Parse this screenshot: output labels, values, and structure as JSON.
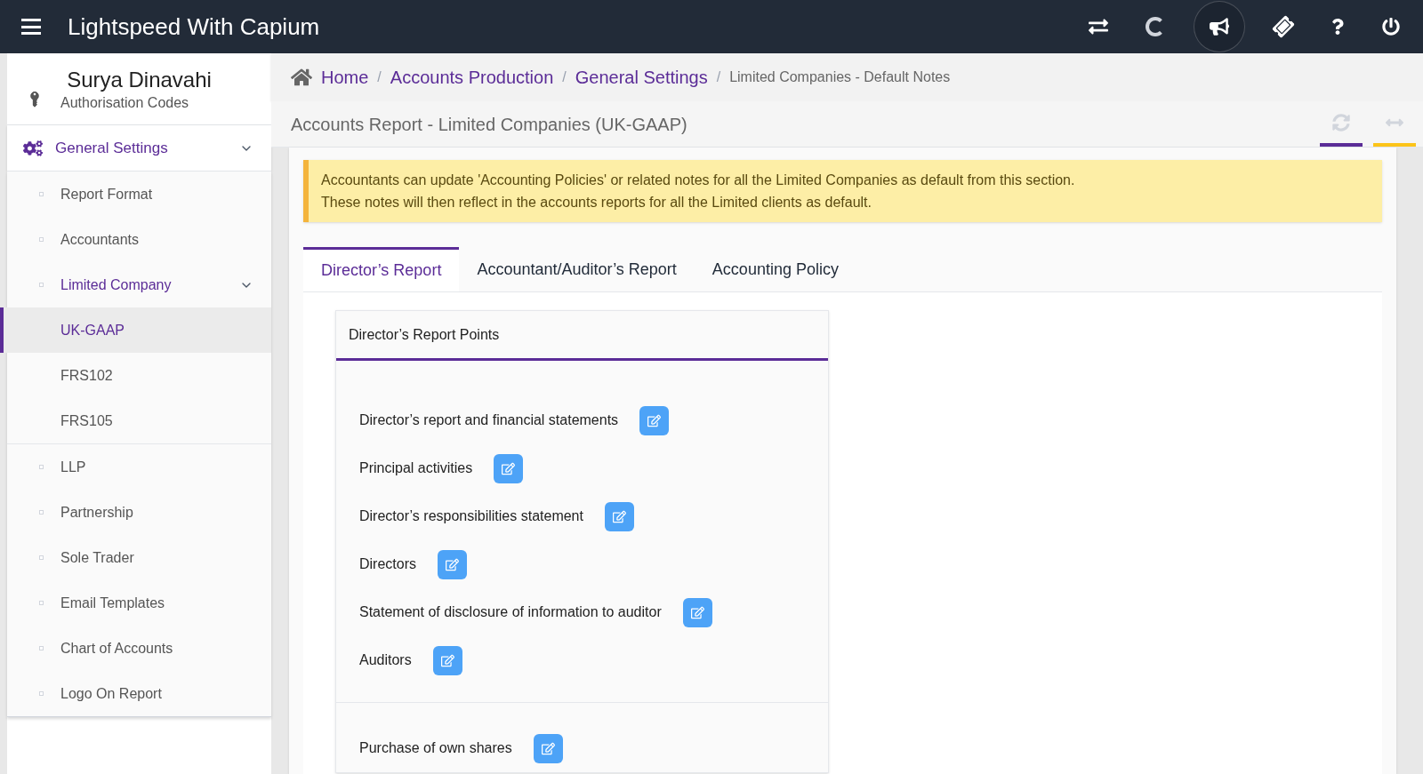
{
  "header": {
    "title": "Lightspeed With Capium"
  },
  "sidebar": {
    "user": "Surya Dinavahi",
    "items": [
      {
        "label": "Authorisation Codes",
        "kind": "link",
        "selected": false
      },
      {
        "label": "General Settings",
        "kind": "group",
        "expanded": true,
        "selected": true,
        "children": [
          {
            "label": "Report Format",
            "selected": false
          },
          {
            "label": "Accountants",
            "selected": false
          },
          {
            "label": "Limited Company",
            "expanded": true,
            "selected": true,
            "children": [
              {
                "label": "UK-GAAP",
                "selected": true
              },
              {
                "label": "FRS102",
                "selected": false
              },
              {
                "label": "FRS105",
                "selected": false
              }
            ]
          },
          {
            "label": "LLP",
            "selected": false
          },
          {
            "label": "Partnership",
            "selected": false
          },
          {
            "label": "Sole Trader",
            "selected": false
          },
          {
            "label": "Email Templates",
            "selected": false
          },
          {
            "label": "Chart of Accounts",
            "selected": false
          },
          {
            "label": "Logo On Report",
            "selected": false
          }
        ]
      }
    ]
  },
  "breadcrumb": [
    {
      "kind": "link",
      "label": "Home"
    },
    {
      "kind": "separator",
      "label": "/"
    },
    {
      "kind": "link",
      "label": "Accounts Production"
    },
    {
      "kind": "separator",
      "label": "/"
    },
    {
      "kind": "link",
      "label": "General Settings"
    },
    {
      "kind": "separator",
      "label": "/"
    },
    {
      "kind": "current",
      "label": "Limited Companies - Default Notes"
    }
  ],
  "page_title": "Accounts Report - Limited Companies (UK-GAAP)",
  "alert": [
    "Accountants can update 'Accounting Policies' or related notes for all the Limited Companies as default from this section.",
    "These notes will then reflect in the accounts reports for all the Limited clients as default."
  ],
  "tabs": [
    {
      "label": "Director’s Report",
      "selected": true
    },
    {
      "label": "Accountant/Auditor’s Report",
      "selected": false
    },
    {
      "label": "Accounting Policy",
      "selected": false
    }
  ],
  "card": {
    "title": "Director’s Report Points",
    "groups": [
      [
        "Director’s report and financial statements",
        "Principal activities",
        "Director’s responsibilities statement",
        "Directors",
        "Statement of disclosure of information to auditor",
        "Auditors"
      ],
      [
        "Purchase of own shares"
      ]
    ]
  }
}
